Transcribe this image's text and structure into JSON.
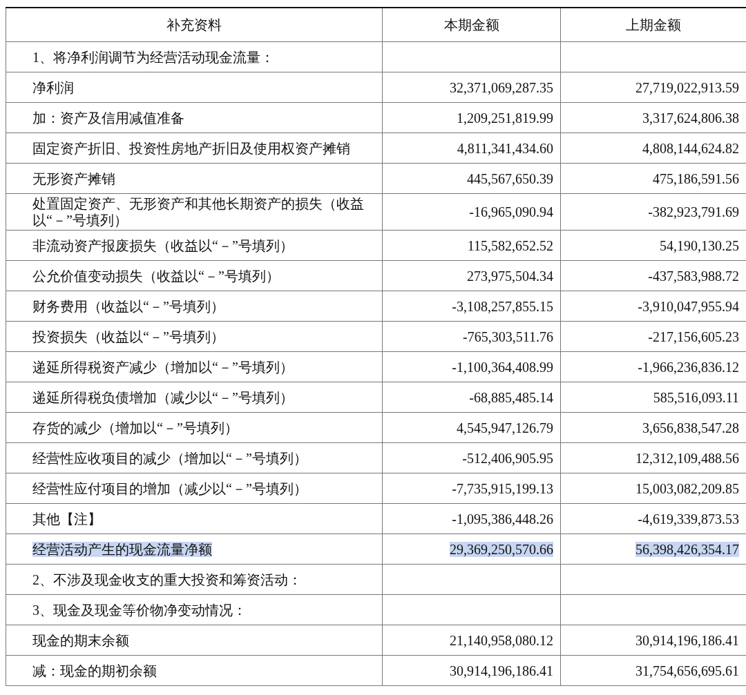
{
  "table": {
    "columns": [
      "补充资料",
      "本期金额",
      "上期金额"
    ],
    "rows": [
      {
        "item": "1、将净利润调节为经营活动现金流量：",
        "current": "",
        "previous": "",
        "highlighted": false
      },
      {
        "item": "净利润",
        "current": "32,371,069,287.35",
        "previous": "27,719,022,913.59",
        "highlighted": false
      },
      {
        "item": "加：资产及信用减值准备",
        "current": "1,209,251,819.99",
        "previous": "3,317,624,806.38",
        "highlighted": false
      },
      {
        "item": "固定资产折旧、投资性房地产折旧及使用权资产摊销",
        "current": "4,811,341,434.60",
        "previous": "4,808,144,624.82",
        "highlighted": false
      },
      {
        "item": "无形资产摊销",
        "current": "445,567,650.39",
        "previous": "475,186,591.56",
        "highlighted": false
      },
      {
        "item": "处置固定资产、无形资产和其他长期资产的损失（收益以“－”号填列）",
        "current": "-16,965,090.94",
        "previous": "-382,923,791.69",
        "highlighted": false
      },
      {
        "item": "非流动资产报废损失（收益以“－”号填列）",
        "current": "115,582,652.52",
        "previous": "54,190,130.25",
        "highlighted": false
      },
      {
        "item": "公允价值变动损失（收益以“－”号填列）",
        "current": "273,975,504.34",
        "previous": "-437,583,988.72",
        "highlighted": false
      },
      {
        "item": "财务费用（收益以“－”号填列）",
        "current": "-3,108,257,855.15",
        "previous": "-3,910,047,955.94",
        "highlighted": false
      },
      {
        "item": "投资损失（收益以“－”号填列）",
        "current": "-765,303,511.76",
        "previous": "-217,156,605.23",
        "highlighted": false
      },
      {
        "item": "递延所得税资产减少（增加以“－”号填列）",
        "current": "-1,100,364,408.99",
        "previous": "-1,966,236,836.12",
        "highlighted": false
      },
      {
        "item": "递延所得税负债增加（减少以“－”号填列）",
        "current": "-68,885,485.14",
        "previous": "585,516,093.11",
        "highlighted": false
      },
      {
        "item": "存货的减少（增加以“－”号填列）",
        "current": "4,545,947,126.79",
        "previous": "3,656,838,547.28",
        "highlighted": false
      },
      {
        "item": "经营性应收项目的减少（增加以“－”号填列）",
        "current": "-512,406,905.95",
        "previous": "12,312,109,488.56",
        "highlighted": false
      },
      {
        "item": "经营性应付项目的增加（减少以“－”号填列）",
        "current": "-7,735,915,199.13",
        "previous": "15,003,082,209.85",
        "highlighted": false
      },
      {
        "item": "其他【注】",
        "current": "-1,095,386,448.26",
        "previous": "-4,619,339,873.53",
        "highlighted": false
      },
      {
        "item": "经营活动产生的现金流量净额",
        "current": "29,369,250,570.66",
        "previous": "56,398,426,354.17",
        "highlighted": true
      },
      {
        "item": "2、不涉及现金收支的重大投资和筹资活动：",
        "current": "",
        "previous": "",
        "highlighted": false
      },
      {
        "item": "3、现金及现金等价物净变动情况：",
        "current": "",
        "previous": "",
        "highlighted": false
      },
      {
        "item": "现金的期末余额",
        "current": "21,140,958,080.12",
        "previous": "30,914,196,186.41",
        "highlighted": false
      },
      {
        "item": "减：现金的期初余额",
        "current": "30,914,196,186.41",
        "previous": "31,754,656,695.61",
        "highlighted": false
      }
    ]
  }
}
